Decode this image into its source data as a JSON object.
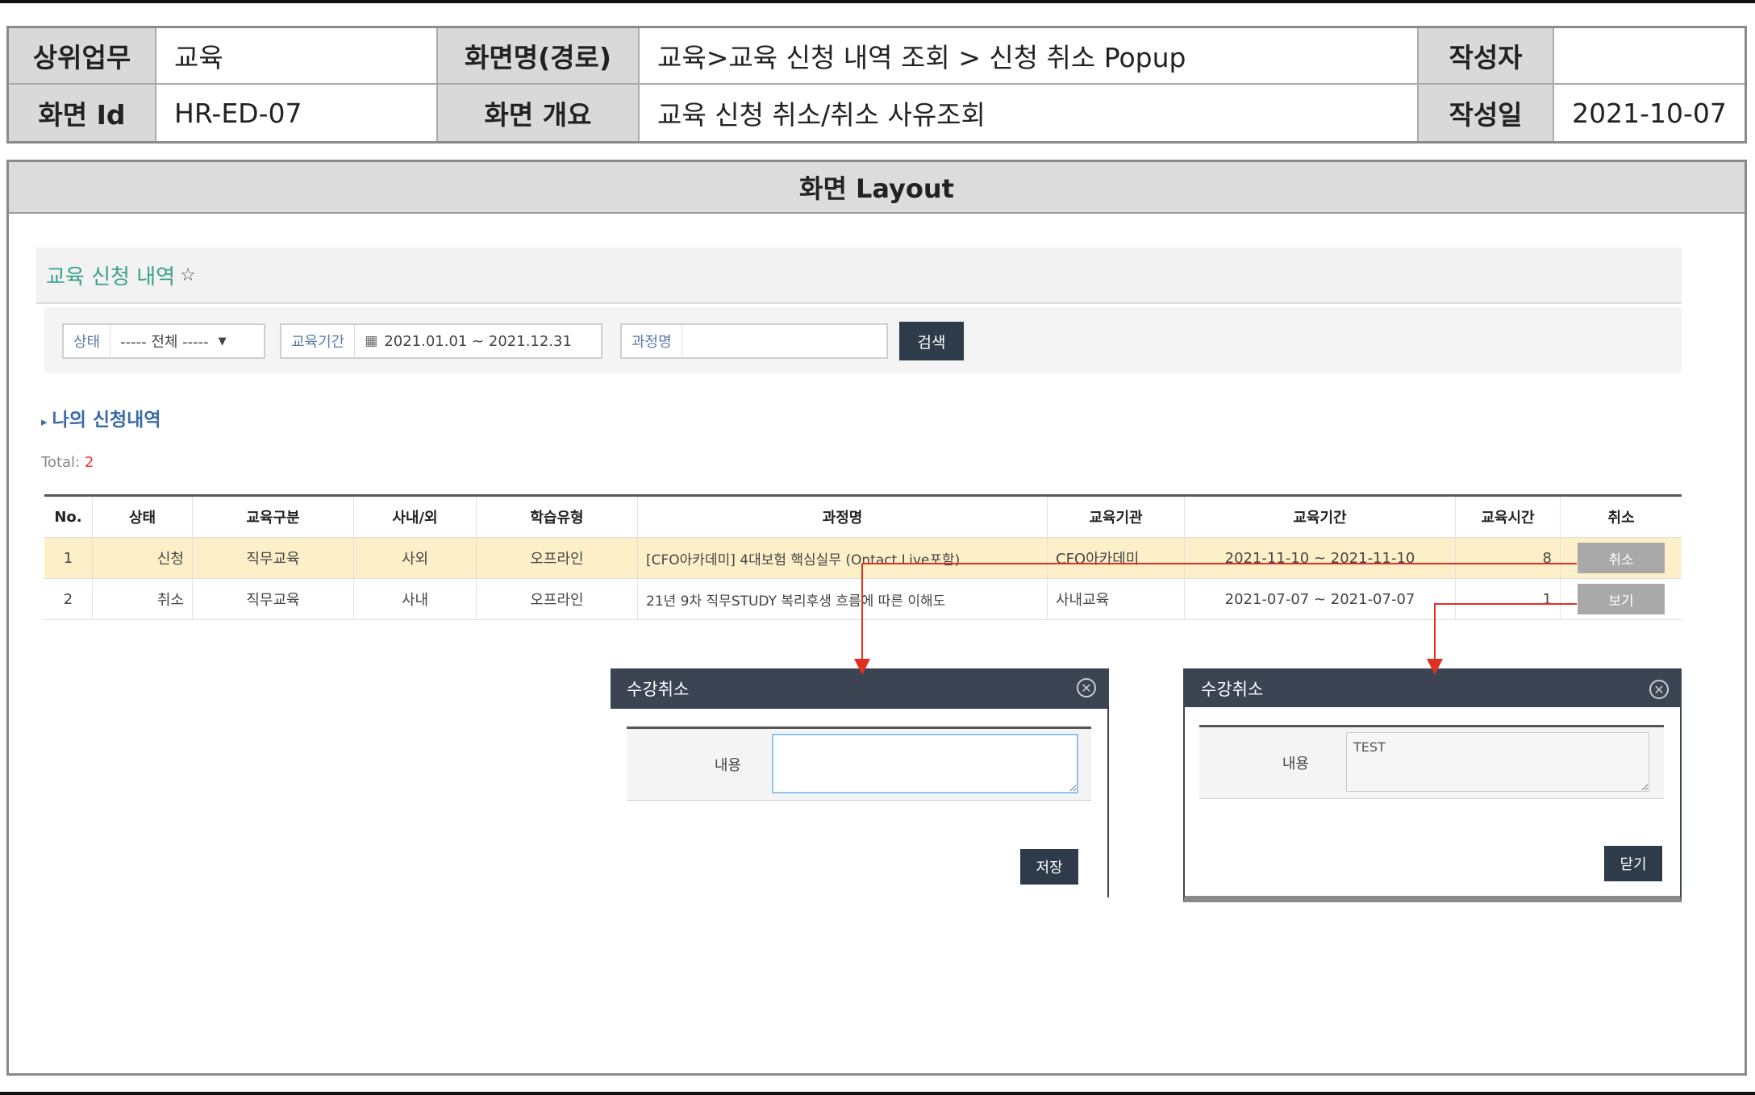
{
  "info": {
    "upper_task_label": "상위업무",
    "upper_task_value": "교육",
    "screen_name_label": "화면명(경로)",
    "screen_name_value": "교육>교육 신청 내역 조회 > 신청 취소 Popup",
    "author_label": "작성자",
    "author_value": "",
    "screen_id_label": "화면 Id",
    "screen_id_value": "HR-ED-07",
    "overview_label": "화면 개요",
    "overview_value": "교육 신청 취소/취소 사유조회",
    "date_label": "작성일",
    "date_value": "2021-10-07"
  },
  "layout_title": "화면 Layout",
  "page": {
    "title": "교육 신청 내역",
    "star": "☆"
  },
  "search": {
    "status_label": "상태",
    "status_value": "----- 전체 -----",
    "period_label": "교육기간",
    "period_value": "2021.01.01 ~ 2021.12.31",
    "course_label": "과정명",
    "course_value": "",
    "search_button": "검색"
  },
  "my_list_title": "나의 신청내역",
  "total_label": "Total:",
  "total_count": "2",
  "table": {
    "headers": [
      "No.",
      "상태",
      "교육구분",
      "사내/외",
      "학습유형",
      "과정명",
      "교육기관",
      "교육기간",
      "교육시간",
      "취소"
    ],
    "rows": [
      [
        "1",
        "신청",
        "직무교육",
        "사외",
        "오프라인",
        "[CFO아카데미] 4대보험 핵심실무 (Ontact Live포함)",
        "CFO아카데미",
        "2021-11-10 ~ 2021-11-10",
        "8",
        "취소"
      ],
      [
        "2",
        "취소",
        "직무교육",
        "사내",
        "오프라인",
        "21년 9차 직무STUDY 복리후생 흐름에 따른 이해도",
        "사내교육",
        "2021-07-07 ~ 2021-07-07",
        "1",
        "보기"
      ]
    ]
  },
  "popup_cancel": {
    "title": "수강취소",
    "field_label": "내용",
    "field_value": "",
    "button": "저장"
  },
  "popup_view": {
    "title": "수강취소",
    "field_label": "내용",
    "field_value": "TEST",
    "button": "닫기"
  },
  "colors": {
    "arrow": "#e03020",
    "selected_row": "#fdf0c9",
    "dark_button": "#2e3b4a"
  }
}
